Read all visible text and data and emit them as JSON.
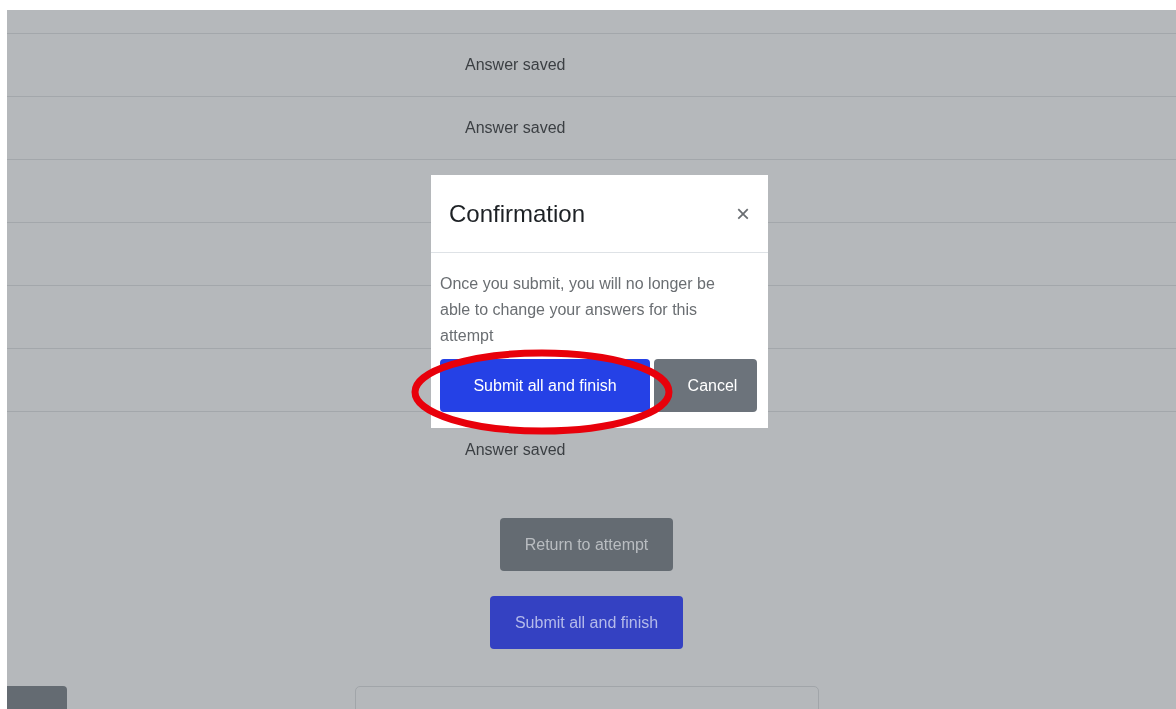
{
  "rows": [
    {
      "status": "Answer saved"
    },
    {
      "status": "Answer saved"
    },
    {},
    {},
    {},
    {},
    {
      "status": "Answer saved"
    }
  ],
  "buttons": [
    {
      "label": "Return to attempt",
      "kind": "secondary"
    },
    {
      "label": "Submit all and finish",
      "kind": "primary"
    }
  ],
  "modal": {
    "title": "Confirmation",
    "close": "×",
    "message": "Once you submit, you will no longer be able to change your answers for this attempt",
    "buttons": [
      {
        "label": "Submit all and finish",
        "kind": "primary"
      },
      {
        "label": "Cancel",
        "kind": "secondary"
      }
    ]
  }
}
